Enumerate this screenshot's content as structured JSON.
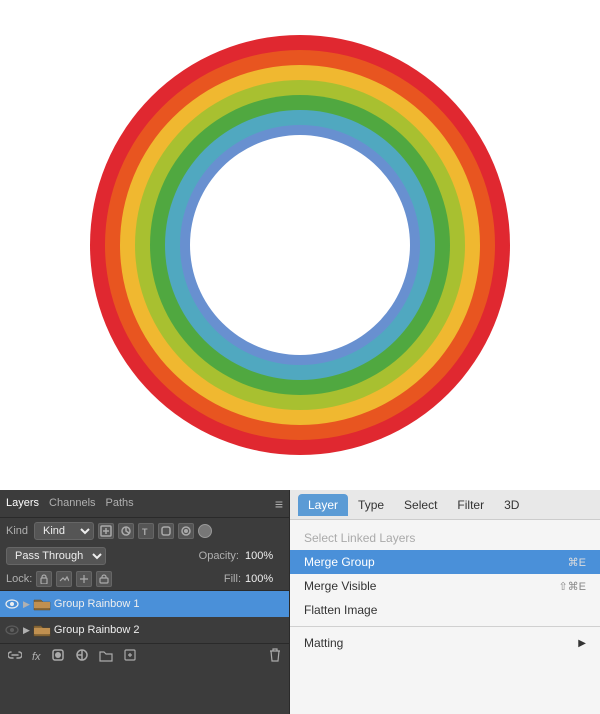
{
  "canvas": {
    "background": "#ffffff"
  },
  "layers_panel": {
    "tabs": [
      {
        "label": "Layers",
        "active": true
      },
      {
        "label": "Channels",
        "active": false
      },
      {
        "label": "Paths",
        "active": false
      }
    ],
    "kind_label": "Kind",
    "kind_value": "Kind",
    "passthrough_label": "Pass Through",
    "opacity_label": "Opacity:",
    "opacity_value": "100%",
    "lock_label": "Lock:",
    "fill_label": "Fill:",
    "fill_value": "100%",
    "layers": [
      {
        "name": "Group Rainbow 1",
        "visible": true,
        "type": "group"
      },
      {
        "name": "Group Rainbow 2",
        "visible": false,
        "type": "group"
      }
    ]
  },
  "menu_header": {
    "items": [
      {
        "label": "Layer",
        "active": true
      },
      {
        "label": "Type",
        "active": false
      },
      {
        "label": "Select",
        "active": false
      },
      {
        "label": "Filter",
        "active": false
      },
      {
        "label": "3D",
        "active": false
      }
    ]
  },
  "menu_items": [
    {
      "label": "Select Linked Layers",
      "shortcut": "",
      "disabled": true,
      "has_arrow": false
    },
    {
      "label": "Merge Group",
      "shortcut": "⌘E",
      "disabled": false,
      "selected": true,
      "has_arrow": false
    },
    {
      "label": "Merge Visible",
      "shortcut": "⇧⌘E",
      "disabled": false,
      "selected": false,
      "has_arrow": false
    },
    {
      "label": "Flatten Image",
      "shortcut": "",
      "disabled": false,
      "selected": false,
      "has_arrow": false
    },
    {
      "label": "",
      "separator": true
    },
    {
      "label": "Matting",
      "shortcut": "",
      "disabled": false,
      "selected": false,
      "has_arrow": true
    }
  ],
  "icons": {
    "menu": "≡",
    "eye": "👁",
    "arrow_right": "▶",
    "folder": "📁",
    "link": "🔗",
    "fx": "fx",
    "layer_mask": "◻",
    "create_group": "📁",
    "adjustment": "◑",
    "trash": "🗑",
    "chevron_down": "▾"
  }
}
